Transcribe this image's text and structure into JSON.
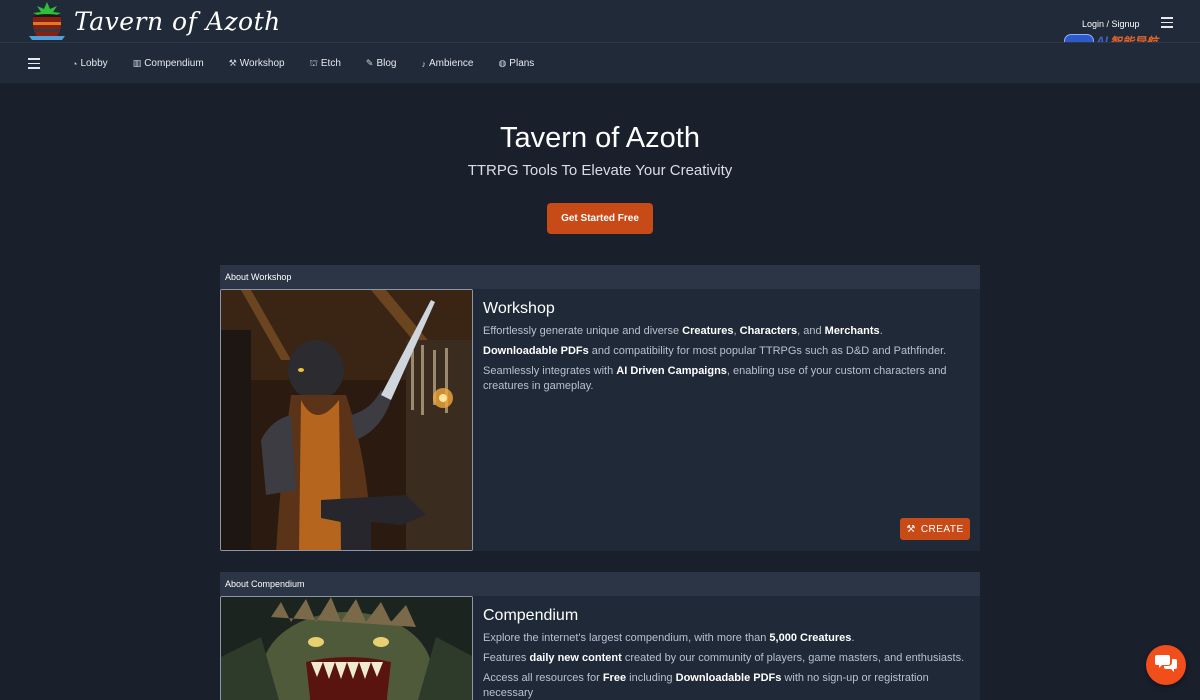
{
  "app": {
    "title": "Tavern of Azoth",
    "login_label": "Login / Signup"
  },
  "watermark": {
    "text_latin": "AI",
    "text_cn": "智能导航"
  },
  "nav": {
    "items": [
      {
        "label": "Lobby",
        "icon": "lobby-icon",
        "glyph": "◔"
      },
      {
        "label": "Compendium",
        "icon": "book-icon",
        "glyph": "▥"
      },
      {
        "label": "Workshop",
        "icon": "hammer-icon",
        "glyph": "⚒"
      },
      {
        "label": "Etch",
        "icon": "etch-icon",
        "glyph": "⛫"
      },
      {
        "label": "Blog",
        "icon": "quill-icon",
        "glyph": "✎"
      },
      {
        "label": "Ambience",
        "icon": "music-icon",
        "glyph": "♪"
      },
      {
        "label": "Plans",
        "icon": "coin-icon",
        "glyph": "◍"
      }
    ]
  },
  "hero": {
    "title": "Tavern of Azoth",
    "subtitle": "TTRPG Tools To Elevate Your Creativity",
    "cta_label": "Get Started Free"
  },
  "workshop": {
    "section_label": "About Workshop",
    "heading": "Workshop",
    "p1": {
      "a": "Effortlessly generate unique and diverse ",
      "b1": "Creatures",
      "c": ", ",
      "b2": "Characters",
      "d": ", and ",
      "b3": "Merchants",
      "e": "."
    },
    "p2": {
      "b1": "Downloadable PDFs",
      "a": " and compatibility for most popular TTRPGs such as D&D and Pathfinder."
    },
    "p3": {
      "a": "Seamlessly integrates with ",
      "b1": "AI Driven Campaigns",
      "c": ", enabling use of your custom characters and creatures in gameplay."
    },
    "create_label": "CREATE"
  },
  "compendium": {
    "section_label": "About Compendium",
    "heading": "Compendium",
    "p1": {
      "a": "Explore the internet's largest compendium, with more than ",
      "b1": "5,000 Creatures",
      "c": "."
    },
    "p2": {
      "a": "Features ",
      "b1": "daily new content",
      "c": " created by our community of players, game masters, and enthusiasts."
    },
    "p3": {
      "a": "Access all resources for ",
      "b1": "Free",
      "c": " including ",
      "b2": "Downloadable PDFs",
      "d": " with no sign-up or registration necessary"
    }
  },
  "colors": {
    "background": "#19202c",
    "bar": "#212a38",
    "accent": "#c84a16",
    "fab": "#f14e1c"
  }
}
